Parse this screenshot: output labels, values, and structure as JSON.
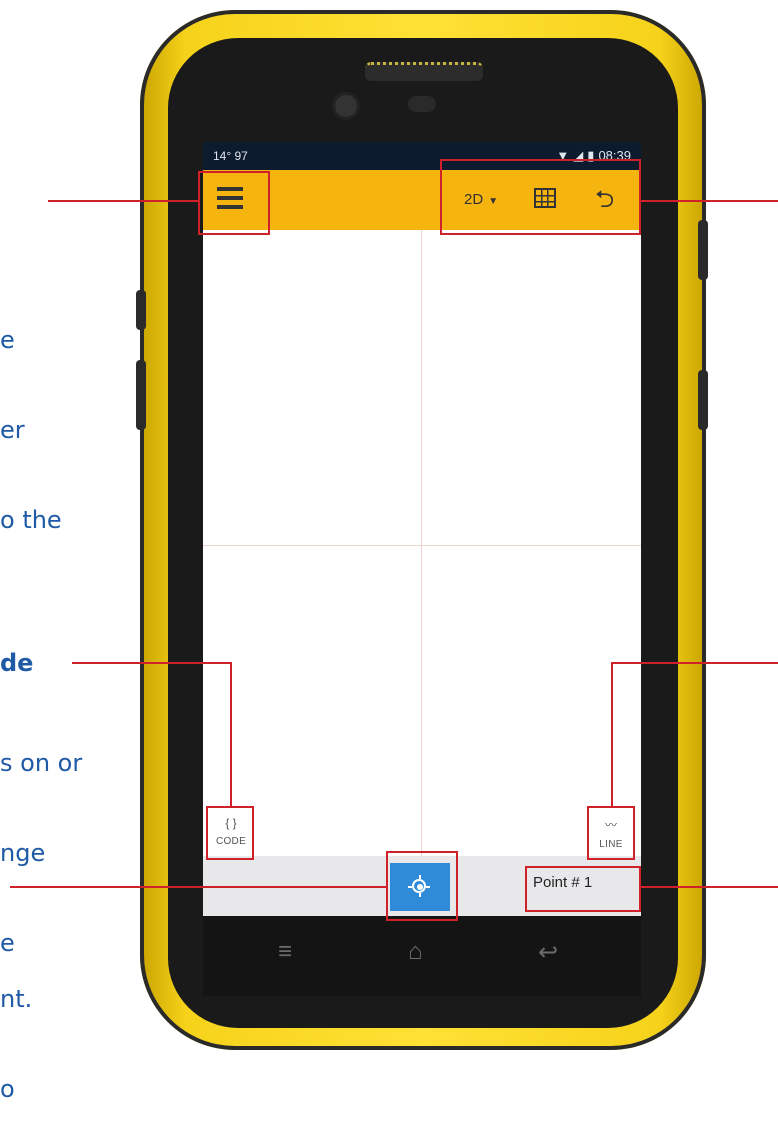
{
  "annotations": {
    "left_top_lines": [
      "e",
      "er",
      "o the"
    ],
    "left_mid_bold": "de",
    "left_mid_lines": [
      "s on or",
      "nge",
      "e"
    ],
    "left_bottom_lines": [
      "nt.",
      "o"
    ]
  },
  "status_bar": {
    "left": "14° 97",
    "wifi_icon": "wifi-icon",
    "signal_icon": "signal-icon",
    "battery_icon": "battery-icon",
    "time": "08:39"
  },
  "app_bar": {
    "menu_icon": "hamburger-menu-icon",
    "view_mode": "2D",
    "grid_icon": "grid-icon",
    "undo_icon": "undo-icon",
    "background": "#f6b40e"
  },
  "tools": {
    "code_glyph": "{ }",
    "code_label": "CODE",
    "line_glyph": "〰",
    "line_label": "LINE"
  },
  "bottom_bar": {
    "locate_icon": "locate-icon",
    "point_label": "Point # 1",
    "locate_color": "#2f8bd8"
  },
  "nav_bar": {
    "menu": "≡",
    "home": "⌂",
    "back": "↩"
  },
  "highlight_color": "#d0202a"
}
